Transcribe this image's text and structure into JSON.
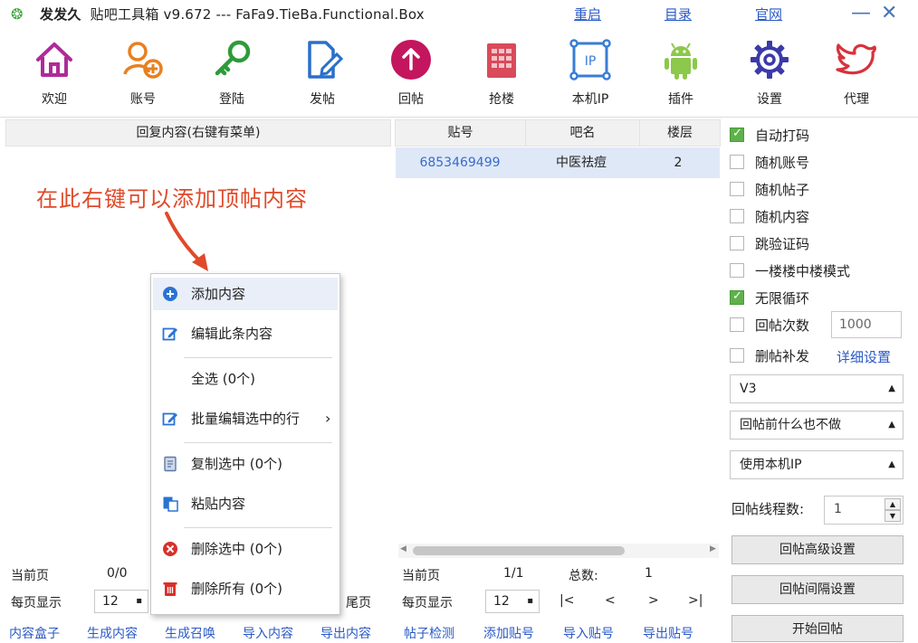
{
  "titlebar": {
    "logo": "❂",
    "app_name": "发发久",
    "title": "贴吧工具箱 v9.672 --- FaFa9.TieBa.Functional.Box",
    "links": [
      "重启",
      "目录",
      "官网"
    ],
    "minimize": "—",
    "close": "✕"
  },
  "toolbar": [
    {
      "label": "欢迎",
      "icon": "home-icon"
    },
    {
      "label": "账号",
      "icon": "add-user-icon"
    },
    {
      "label": "登陆",
      "icon": "key-icon"
    },
    {
      "label": "发帖",
      "icon": "edit-document-icon"
    },
    {
      "label": "回帖",
      "icon": "upload-arrow-icon"
    },
    {
      "label": "抢楼",
      "icon": "building-icon"
    },
    {
      "label": "本机IP",
      "icon": "ip-icon"
    },
    {
      "label": "插件",
      "icon": "android-icon"
    },
    {
      "label": "设置",
      "icon": "gear-icon"
    },
    {
      "label": "代理",
      "icon": "bird-icon"
    }
  ],
  "left_panel": {
    "header": "回复内容(右键有菜单)",
    "annotation": "在此右键可以添加顶帖内容",
    "current_page_label": "当前页",
    "current_page_value": "0/0",
    "per_page_label": "每页显示",
    "per_page_value": "12",
    "last_page": "尾页",
    "bottom_links": [
      "内容盒子",
      "生成内容",
      "生成召唤",
      "导入内容",
      "导出内容"
    ]
  },
  "context_menu": {
    "items": [
      {
        "label": "添加内容",
        "icon": "plus-circle-icon"
      },
      {
        "label": "编辑此条内容",
        "icon": "edit-icon"
      },
      {
        "label": "全选 (0个)",
        "icon": ""
      },
      {
        "label": "批量编辑选中的行",
        "icon": "edit-icon",
        "submenu": "›"
      },
      {
        "label": "复制选中 (0个)",
        "icon": "copy-icon"
      },
      {
        "label": "粘贴内容",
        "icon": "paste-icon"
      },
      {
        "label": "删除选中 (0个)",
        "icon": "delete-circle-icon"
      },
      {
        "label": "删除所有 (0个)",
        "icon": "trash-icon"
      }
    ]
  },
  "middle_panel": {
    "columns": [
      "贴号",
      "吧名",
      "楼层"
    ],
    "rows": [
      {
        "post_id": "6853469499",
        "bar_name": "中医祛痘",
        "floor": "2"
      }
    ],
    "current_page_label": "当前页",
    "current_page_value": "1/1",
    "total_label": "总数:",
    "total_value": "1",
    "per_page_label": "每页显示",
    "per_page_value": "12",
    "nav": [
      "|<",
      "<",
      ">",
      ">|"
    ],
    "bottom_links": [
      "帖子检测",
      "添加贴号",
      "导入贴号",
      "导出贴号"
    ]
  },
  "right_panel": {
    "checkboxes": [
      {
        "label": "自动打码",
        "checked": true
      },
      {
        "label": "随机账号",
        "checked": false
      },
      {
        "label": "随机帖子",
        "checked": false
      },
      {
        "label": "随机内容",
        "checked": false
      },
      {
        "label": "跳验证码",
        "checked": false
      },
      {
        "label": "一楼楼中楼模式",
        "checked": false
      },
      {
        "label": "无限循环",
        "checked": true
      },
      {
        "label": "回帖次数",
        "checked": false
      },
      {
        "label": "删帖补发",
        "checked": false
      }
    ],
    "reply_count_value": "1000",
    "detail_settings": "详细设置",
    "dropdowns": [
      "V3",
      "回帖前什么也不做",
      "使用本机IP"
    ],
    "thread_count_label": "回帖线程数:",
    "thread_count_value": "1",
    "buttons": [
      "回帖高级设置",
      "回帖间隔设置",
      "开始回帖"
    ]
  },
  "colors": {
    "accent_link": "#2a59c6",
    "annotation": "#e04a2a",
    "selected_row": "#dfe8f7",
    "checkbox_on": "#5db24a"
  }
}
